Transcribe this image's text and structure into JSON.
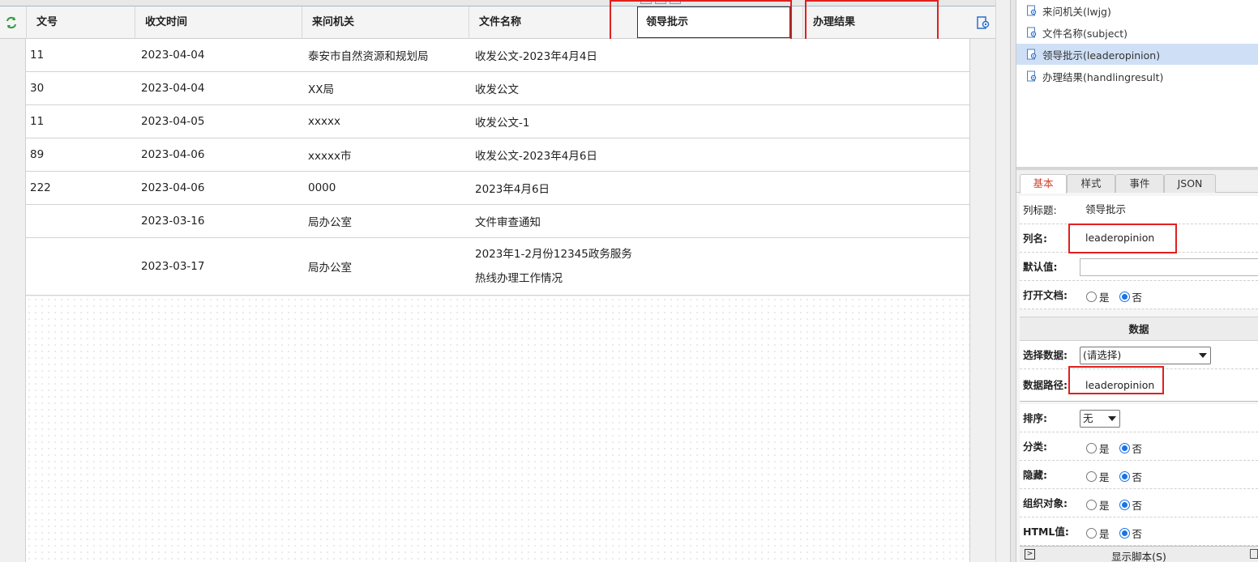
{
  "grid": {
    "columns": [
      "文号",
      "收文时间",
      "来问机关",
      "文件名称",
      "领导批示",
      "办理结果"
    ],
    "rows": [
      {
        "num": "11",
        "date": "2023-04-04",
        "org": "泰安市自然资源和规划局",
        "title": [
          "收发公文-2023年4月4日"
        ]
      },
      {
        "num": "30",
        "date": "2023-04-04",
        "org": "XX局",
        "title": [
          "收发公文"
        ]
      },
      {
        "num": "11",
        "date": "2023-04-05",
        "org": "xxxxx",
        "title": [
          "收发公文-1"
        ]
      },
      {
        "num": "89",
        "date": "2023-04-06",
        "org": "xxxxx市",
        "title": [
          "收发公文-2023年4月6日"
        ]
      },
      {
        "num": "222",
        "date": "2023-04-06",
        "org": "0000",
        "title": [
          "2023年4月6日"
        ]
      },
      {
        "num": "",
        "date": "2023-03-16",
        "org": "局办公室",
        "title": [
          "文件审查通知"
        ]
      },
      {
        "num": "",
        "date": "2023-03-17",
        "org": "局办公室",
        "title": [
          "2023年1-2月份12345政务服务",
          "热线办理工作情况"
        ]
      }
    ]
  },
  "field_tree": {
    "items": [
      {
        "label": "来问机关(lwjg)",
        "selected": false
      },
      {
        "label": "文件名称(subject)",
        "selected": false
      },
      {
        "label": "领导批示(leaderopinion)",
        "selected": true
      },
      {
        "label": "办理结果(handlingresult)",
        "selected": false
      }
    ]
  },
  "props": {
    "tabs": [
      "基本",
      "样式",
      "事件",
      "JSON"
    ],
    "col_title_label": "列标题:",
    "col_title_value": "领导批示",
    "col_name_label": "列名:",
    "col_name_value": "leaderopinion",
    "default_label": "默认值:",
    "default_value": "",
    "open_doc_label": "打开文档:",
    "yes": "是",
    "no": "否",
    "data_section": "数据",
    "select_data_label": "选择数据:",
    "select_data_value": "(请选择)",
    "data_path_label": "数据路径:",
    "data_path_value": "leaderopinion",
    "sort_label": "排序:",
    "sort_value": "无",
    "group_label": "分类:",
    "hidden_label": "隐藏:",
    "org_obj_label": "组织对象:",
    "html_label": "HTML值:",
    "show_script": "显示脚本(S)"
  },
  "colors": {
    "highlight": "#e0201f",
    "selected_row": "#cfe0f6",
    "radio_on": "#1a73e8"
  }
}
